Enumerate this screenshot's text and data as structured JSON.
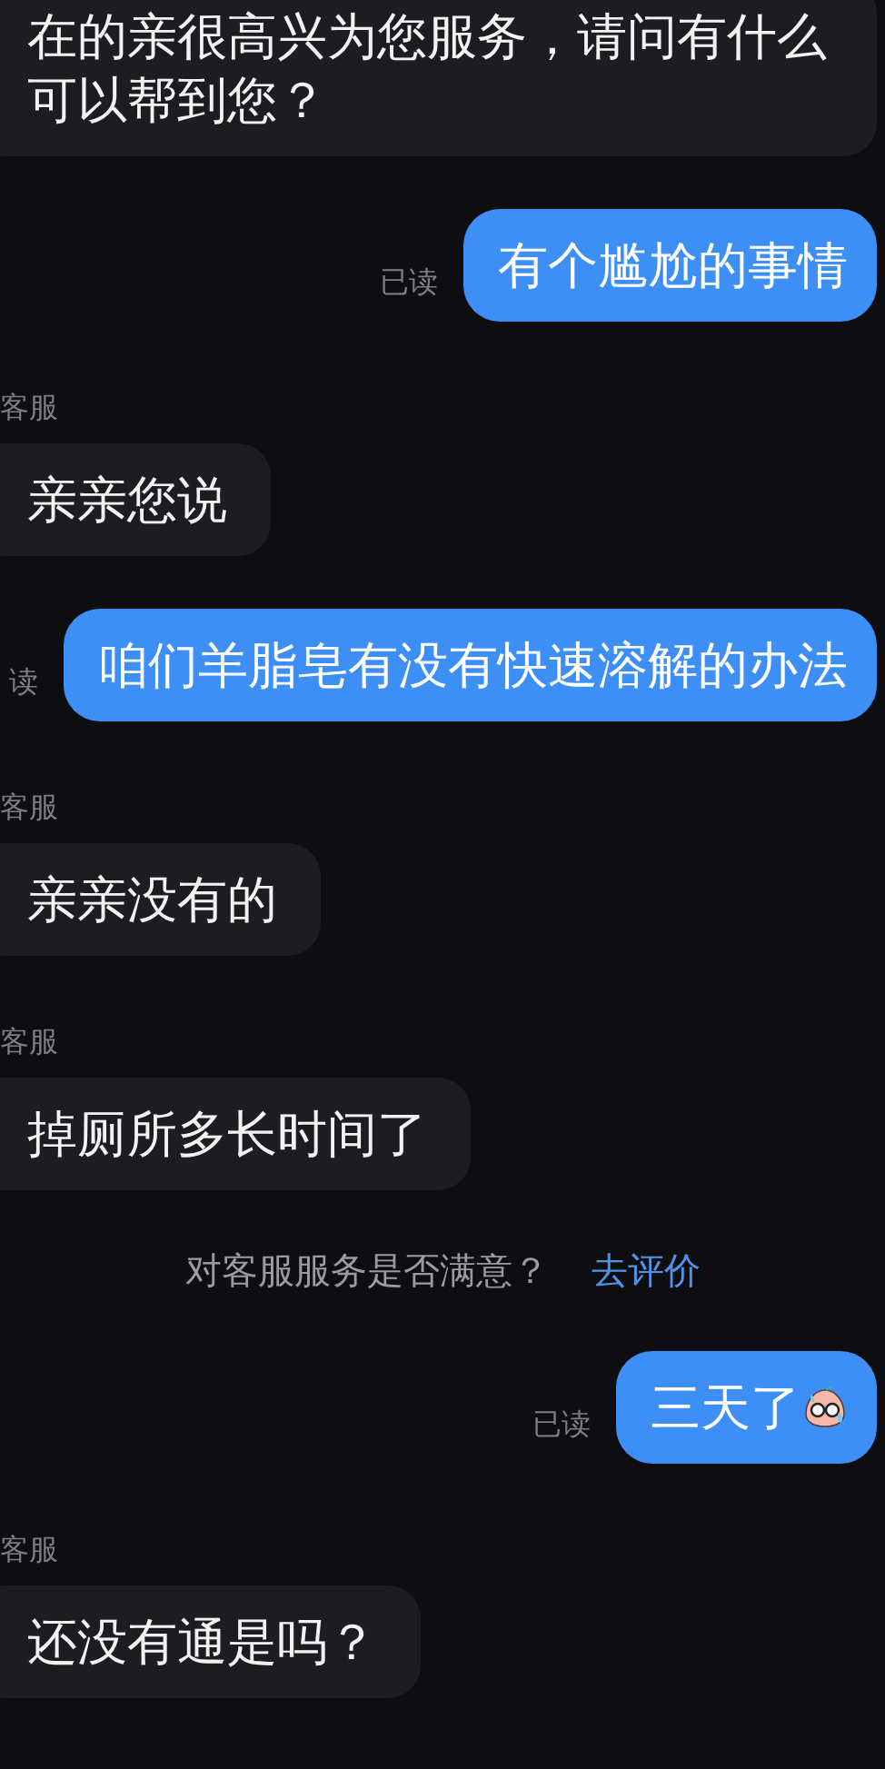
{
  "messages": [
    {
      "kind": "agent",
      "text": "在的亲很高兴为您服务，请问有什么可以帮到您？"
    },
    {
      "kind": "user",
      "text": "有个尴尬的事情",
      "receipt": "已读"
    },
    {
      "kind": "agent",
      "sender": "客服",
      "text": "亲亲您说"
    },
    {
      "kind": "user",
      "text": "咱们羊脂皂有没有快速溶解的办法",
      "receipt": "读"
    },
    {
      "kind": "agent",
      "sender": "客服",
      "text": "亲亲没有的"
    },
    {
      "kind": "agent",
      "sender": "客服",
      "text": "掉厕所多长时间了"
    },
    {
      "kind": "survey",
      "text": "对客服服务是否满意？",
      "link": "去评价"
    },
    {
      "kind": "user",
      "text": "三天了",
      "emoji": true,
      "receipt": "已读"
    },
    {
      "kind": "agent",
      "sender": "客服",
      "text": "还没有通是吗？"
    }
  ]
}
